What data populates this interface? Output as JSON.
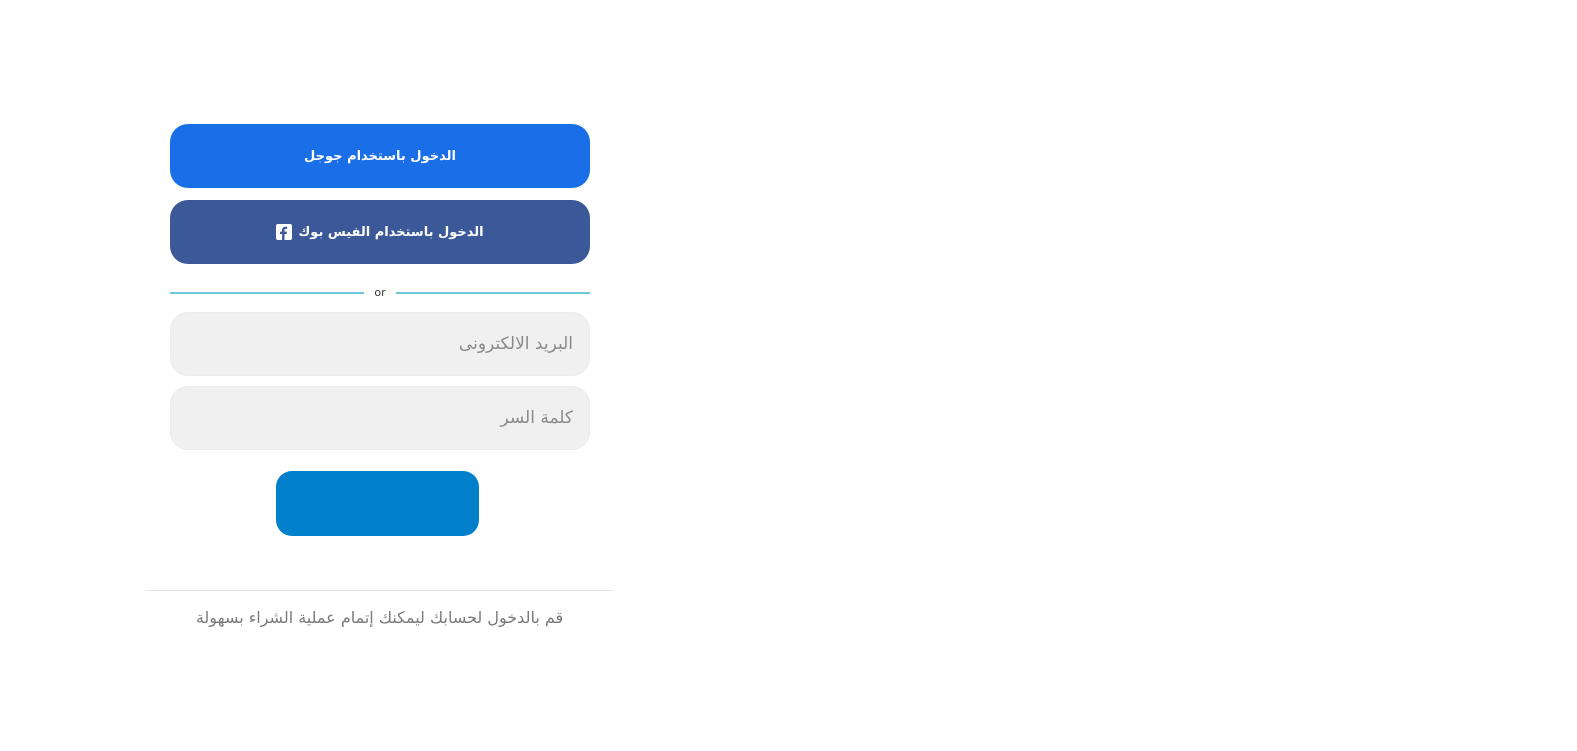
{
  "login": {
    "google_button_label": "الدخول باستخدام جوجل",
    "facebook_button_label": "الدخول باستخدام الفيس بوك",
    "divider_text": "or",
    "email_placeholder": "البريد الالكترونى",
    "password_placeholder": "كلمة السر",
    "submit_label": ""
  },
  "footer": {
    "message": "قم بالدخول لحسابك ليمكنك إتمام عملية الشراء بسهولة"
  },
  "icons": {
    "facebook": "facebook-icon"
  },
  "colors": {
    "google_button": "#1a6ee8",
    "facebook_button": "#3b5998",
    "submit_button": "#0080cb",
    "divider_line": "#6ec6d6",
    "input_background": "#f0f0f0"
  }
}
